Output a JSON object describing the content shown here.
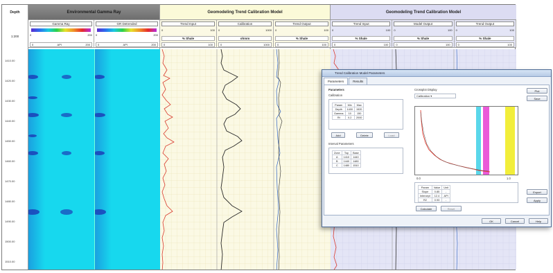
{
  "window": {
    "depth_header": "Depth",
    "depth_unit": "1:200",
    "depth_ticks": [
      "1410.00",
      "1420.00",
      "1430.00",
      "1440.00",
      "1450.00",
      "1460.00",
      "1470.00",
      "1480.00",
      "1490.00",
      "1500.00",
      "1510.00"
    ]
  },
  "sections": [
    {
      "title": "Environmental Gamma Ray"
    },
    {
      "title": "Geomodeling Trend Calibration Model"
    },
    {
      "title": "Geomodeling Trend Calibration Model"
    }
  ],
  "tracks": [
    {
      "name": "Gamma Ray",
      "scale_left": "0",
      "scale_right": "200",
      "unit": "API",
      "vals_left": "0",
      "vals_right": "200"
    },
    {
      "name": "GR Detrended",
      "scale_left": "0",
      "scale_right": "200",
      "unit": "API",
      "vals_left": "0",
      "vals_right": "200"
    },
    {
      "name": "Trend Input",
      "scale_left": "0",
      "scale_right": "100",
      "unit": "% Shale",
      "vals_left": "0",
      "vals_right": "100"
    },
    {
      "name": "Calibration",
      "scale_left": "0",
      "scale_right": "1000",
      "unit": "ohmm",
      "vals_left": "0",
      "vals_right": "1000"
    },
    {
      "name": "Trend Output",
      "scale_left": "0",
      "scale_right": "100",
      "unit": "% Shale",
      "vals_left": "0",
      "vals_right": "100"
    },
    {
      "name": "Trend Input",
      "scale_left": "0",
      "scale_right": "100",
      "unit": "% Shale",
      "vals_left": "0",
      "vals_right": "100"
    },
    {
      "name": "Model Output",
      "scale_left": "0",
      "scale_right": "100",
      "unit": "% Shale",
      "vals_left": "0",
      "vals_right": "100"
    },
    {
      "name": "Trend Output",
      "scale_left": "0",
      "scale_right": "100",
      "unit": "% Shale",
      "vals_left": "0",
      "vals_right": "100"
    }
  ],
  "dialog": {
    "title": "Trend Calibration Model Parameters",
    "tabs": [
      "Parameters",
      "Results"
    ],
    "section_title": "Parameters",
    "group1_label": "Calibration",
    "group2_label": "Interval Parameters",
    "table1": {
      "headers": [
        "Param",
        "Min",
        "Max"
      ],
      "rows": [
        [
          "Depth",
          "1400",
          "1520"
        ],
        [
          "Gamma",
          "10",
          "150"
        ],
        [
          "Rt",
          "0.2",
          "2000"
        ]
      ]
    },
    "table2": {
      "headers": [
        "Zone",
        "Top",
        "Base"
      ],
      "rows": [
        [
          "A",
          "1410",
          "1440"
        ],
        [
          "B",
          "1440",
          "1480"
        ],
        [
          "C",
          "1480",
          "1510"
        ]
      ]
    },
    "btn_add": "Add",
    "btn_delete": "Delete",
    "btn_load": "Load",
    "plot_label": "Crossplot Display",
    "plot_select": "Calibration",
    "x_min": "0.0",
    "x_max": "1.0",
    "table3": {
      "headers": [
        "Param",
        "Value",
        "Unit"
      ],
      "rows": [
        [
          "Slope",
          "0.85",
          "-"
        ],
        [
          "Intercept",
          "12.4",
          "API"
        ],
        [
          "R2",
          "0.93",
          "-"
        ]
      ]
    },
    "btn_calc": "Calculate",
    "btn_reset": "Reset",
    "btn_export": "Export",
    "btn_ok": "OK",
    "btn_cancel": "Cancel",
    "btn_help": "Help",
    "btn_apply": "Apply",
    "btn_plot": "Plot",
    "btn_save": "Save"
  }
}
